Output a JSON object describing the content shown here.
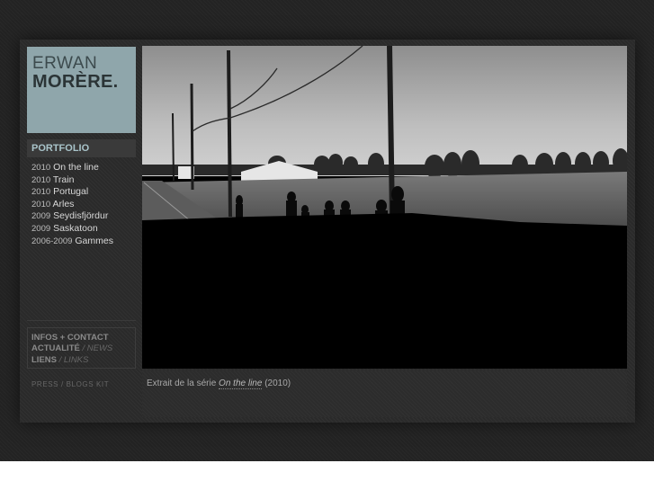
{
  "logo": {
    "line1": "ERWAN",
    "line2": "MORÈRE."
  },
  "nav": {
    "portfolio_label": "PORTFOLIO",
    "series": [
      {
        "year": "2010",
        "name": "On the line"
      },
      {
        "year": "2010",
        "name": "Train"
      },
      {
        "year": "2010",
        "name": "Portugal"
      },
      {
        "year": "2010",
        "name": "Arles"
      },
      {
        "year": "2009",
        "name": "Seydisfjördur"
      },
      {
        "year": "2009",
        "name": "Saskatoon"
      },
      {
        "year": "2006-2009",
        "name": "Gammes"
      }
    ]
  },
  "info": {
    "infos_contact": "INFOS + CONTACT",
    "actualite": "ACTUALITÉ",
    "news": "/ NEWS",
    "liens": "LIENS",
    "links": "/ LINKS"
  },
  "press": "PRESS / BLOGS KIT",
  "caption": {
    "prefix": "Extrait de la série",
    "series_link": "On the line",
    "year": "(2010)"
  },
  "colors": {
    "logo_bg": "#8fa6ab",
    "accent": "#a9c4ca",
    "page_bg": "#232323"
  }
}
